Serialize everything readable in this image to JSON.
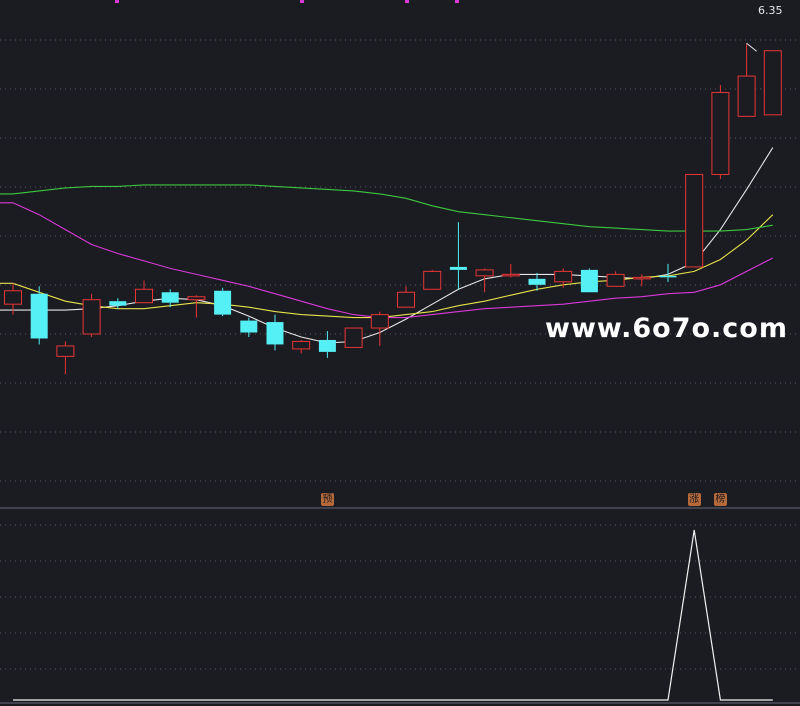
{
  "watermark": "www.6o7o.com",
  "peak_label": "6.35",
  "markers": [
    {
      "text": "预",
      "index": 12
    },
    {
      "text": "涨",
      "index": 26
    },
    {
      "text": "榜",
      "index": 27
    }
  ],
  "colors": {
    "background": "#1b1b22",
    "up": "#e83535",
    "down": "#54f0f5",
    "ma_white": "#e6e6e6",
    "ma_yellow": "#e6e24a",
    "ma_magenta": "#d83ad8",
    "ma_green": "#3dc83d",
    "grid": "#5a5a66",
    "indicator": "#f2f2f2"
  },
  "chart_data": [
    {
      "type": "candlestick",
      "ylim": [
        3.3,
        6.6
      ],
      "candles": [
        {
          "open": 4.6,
          "high": 4.74,
          "low": 4.53,
          "close": 4.69
        },
        {
          "open": 4.67,
          "high": 4.72,
          "low": 4.33,
          "close": 4.37
        },
        {
          "open": 4.25,
          "high": 4.35,
          "low": 4.13,
          "close": 4.32
        },
        {
          "open": 4.4,
          "high": 4.67,
          "low": 4.38,
          "close": 4.63
        },
        {
          "open": 4.62,
          "high": 4.64,
          "low": 4.57,
          "close": 4.59
        },
        {
          "open": 4.61,
          "high": 4.76,
          "low": 4.61,
          "close": 4.7
        },
        {
          "open": 4.68,
          "high": 4.7,
          "low": 4.58,
          "close": 4.61
        },
        {
          "open": 4.63,
          "high": 4.66,
          "low": 4.51,
          "close": 4.65
        },
        {
          "open": 4.69,
          "high": 4.71,
          "low": 4.52,
          "close": 4.53
        },
        {
          "open": 4.49,
          "high": 4.51,
          "low": 4.38,
          "close": 4.41
        },
        {
          "open": 4.48,
          "high": 4.53,
          "low": 4.29,
          "close": 4.33
        },
        {
          "open": 4.3,
          "high": 4.36,
          "low": 4.27,
          "close": 4.35
        },
        {
          "open": 4.36,
          "high": 4.42,
          "low": 4.24,
          "close": 4.28
        },
        {
          "open": 4.31,
          "high": 4.43,
          "low": 4.32,
          "close": 4.44
        },
        {
          "open": 4.44,
          "high": 4.55,
          "low": 4.32,
          "close": 4.53
        },
        {
          "open": 4.58,
          "high": 4.72,
          "low": 4.58,
          "close": 4.68
        },
        {
          "open": 4.7,
          "high": 4.83,
          "low": 4.7,
          "close": 4.82
        },
        {
          "open": 4.85,
          "high": 5.15,
          "low": 4.7,
          "close": 4.83
        },
        {
          "open": 4.79,
          "high": 4.84,
          "low": 4.68,
          "close": 4.83
        },
        {
          "open": 4.8,
          "high": 4.87,
          "low": 4.78,
          "close": 4.8
        },
        {
          "open": 4.77,
          "high": 4.81,
          "low": 4.69,
          "close": 4.73
        },
        {
          "open": 4.75,
          "high": 4.84,
          "low": 4.71,
          "close": 4.82
        },
        {
          "open": 4.83,
          "high": 4.84,
          "low": 4.68,
          "close": 4.68
        },
        {
          "open": 4.72,
          "high": 4.82,
          "low": 4.72,
          "close": 4.8
        },
        {
          "open": 4.78,
          "high": 4.8,
          "low": 4.72,
          "close": 4.78
        },
        {
          "open": 4.79,
          "high": 4.87,
          "low": 4.75,
          "close": 4.78
        },
        {
          "open": 4.85,
          "high": 5.47,
          "low": 4.85,
          "close": 5.47
        },
        {
          "open": 5.47,
          "high": 6.07,
          "low": 5.44,
          "close": 6.02
        },
        {
          "open": 5.86,
          "high": 6.35,
          "low": 5.86,
          "close": 6.13
        },
        {
          "open": 5.87,
          "high": 6.3,
          "low": 5.87,
          "close": 6.3
        }
      ],
      "moving_averages": [
        {
          "color_key": "ma_white",
          "values": [
            4.56,
            4.56,
            4.56,
            4.57,
            4.59,
            4.62,
            4.64,
            4.63,
            4.59,
            4.52,
            4.44,
            4.38,
            4.34,
            4.35,
            4.41,
            4.5,
            4.6,
            4.7,
            4.77,
            4.8,
            4.8,
            4.8,
            4.79,
            4.78,
            4.77,
            4.8,
            4.88,
            5.1,
            5.37,
            5.65
          ]
        },
        {
          "color_key": "ma_yellow",
          "values": [
            4.74,
            4.68,
            4.62,
            4.59,
            4.57,
            4.57,
            4.59,
            4.61,
            4.6,
            4.58,
            4.55,
            4.53,
            4.52,
            4.51,
            4.51,
            4.53,
            4.55,
            4.59,
            4.62,
            4.66,
            4.7,
            4.73,
            4.75,
            4.76,
            4.78,
            4.79,
            4.82,
            4.9,
            5.03,
            5.2
          ]
        },
        {
          "color_key": "ma_magenta",
          "values": [
            5.28,
            5.2,
            5.1,
            5.0,
            4.94,
            4.89,
            4.84,
            4.8,
            4.76,
            4.72,
            4.67,
            4.62,
            4.57,
            4.53,
            4.51,
            4.51,
            4.53,
            4.55,
            4.57,
            4.58,
            4.59,
            4.6,
            4.62,
            4.64,
            4.65,
            4.67,
            4.68,
            4.73,
            4.82,
            4.91
          ]
        },
        {
          "color_key": "ma_green",
          "values": [
            5.34,
            5.36,
            5.38,
            5.39,
            5.39,
            5.4,
            5.4,
            5.4,
            5.4,
            5.4,
            5.39,
            5.38,
            5.37,
            5.36,
            5.34,
            5.31,
            5.26,
            5.22,
            5.2,
            5.18,
            5.16,
            5.14,
            5.12,
            5.11,
            5.1,
            5.09,
            5.09,
            5.09,
            5.1,
            5.13
          ]
        }
      ]
    },
    {
      "type": "line",
      "ylim": [
        0,
        1
      ],
      "values": [
        0,
        0,
        0,
        0,
        0,
        0,
        0,
        0,
        0,
        0,
        0,
        0,
        0,
        0,
        0,
        0,
        0,
        0,
        0,
        0,
        0,
        0,
        0,
        0,
        0,
        0,
        1,
        0,
        0,
        0
      ]
    }
  ]
}
